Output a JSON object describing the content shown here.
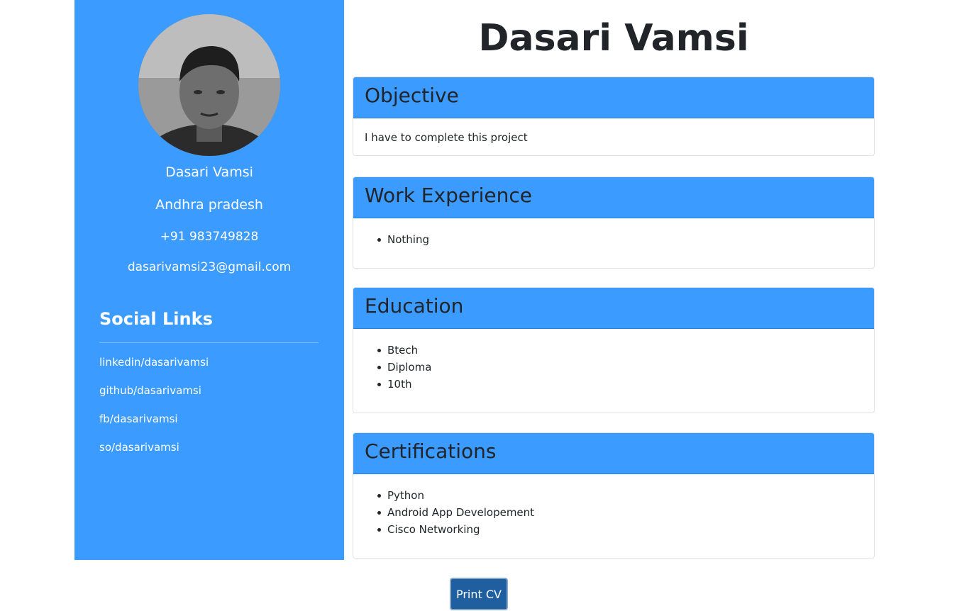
{
  "sidebar": {
    "avatar_icon": "profile-photo",
    "name": "Dasari Vamsi",
    "location": "Andhra pradesh",
    "phone": "+91 983749828",
    "email": "dasarivamsi23@gmail.com",
    "social_title": "Social Links",
    "social_links": [
      "linkedin/dasarivamsi",
      "github/dasarivamsi",
      "fb/dasarivamsi",
      "so/dasarivamsi"
    ]
  },
  "main": {
    "title": "Dasari Vamsi",
    "objective": {
      "heading": "Objective",
      "text": "I have to complete this project"
    },
    "work_experience": {
      "heading": "Work Experience",
      "items": [
        "Nothing"
      ]
    },
    "education": {
      "heading": "Education",
      "items": [
        "Btech",
        "Diploma",
        "10th"
      ]
    },
    "certifications": {
      "heading": "Certifications",
      "items": [
        "Python",
        "Android App Developement",
        "Cisco Networking"
      ]
    }
  },
  "print_button": "Print CV",
  "colors": {
    "accent": "#3c9bff",
    "button": "#1f5fa0"
  }
}
